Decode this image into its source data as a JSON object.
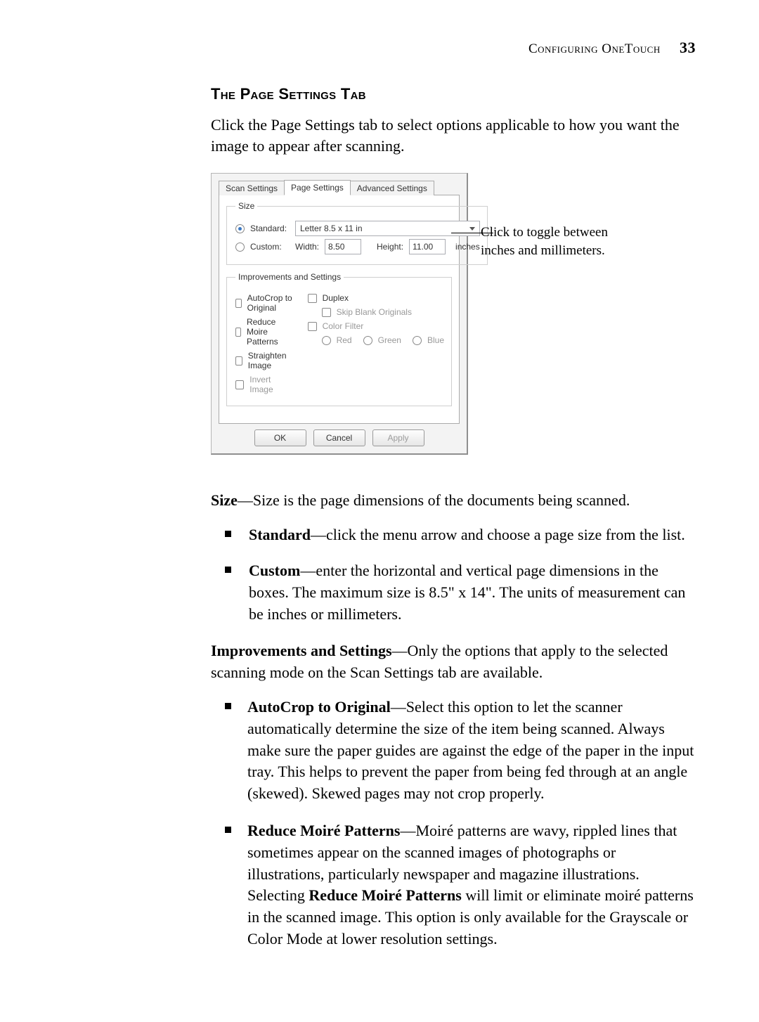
{
  "header": {
    "section": "Configuring OneTouch",
    "page_number": "33"
  },
  "title": "The Page Settings Tab",
  "intro": "Click the Page Settings tab to select options applicable to how you want the image to appear after scanning.",
  "dialog": {
    "tabs": {
      "scan": "Scan Settings",
      "page": "Page Settings",
      "advanced": "Advanced Settings"
    },
    "size_group": {
      "legend": "Size",
      "standard_label": "Standard:",
      "standard_value": "Letter 8.5 x 11 in",
      "custom_label": "Custom:",
      "width_label": "Width:",
      "width_value": "8.50",
      "height_label": "Height:",
      "height_value": "11.00",
      "units": "inches"
    },
    "improve_group": {
      "legend": "Improvements and Settings",
      "autocrop": "AutoCrop to Original",
      "moire": "Reduce Moire Patterns",
      "straighten": "Straighten Image",
      "invert": "Invert Image",
      "duplex": "Duplex",
      "skip_blank": "Skip Blank Originals",
      "color_filter": "Color Filter",
      "red": "Red",
      "green": "Green",
      "blue": "Blue"
    },
    "buttons": {
      "ok": "OK",
      "cancel": "Cancel",
      "apply": "Apply"
    }
  },
  "callout": "Click to toggle between inches and millimeters.",
  "body": {
    "size_para_lead": "Size",
    "size_para_rest": "—Size is the page dimensions of the documents being scanned.",
    "standard_lead": "Standard",
    "standard_rest": "—click the menu arrow and choose a page size from the list.",
    "custom_lead": "Custom",
    "custom_rest": "—enter the horizontal and vertical page dimensions in the boxes. The maximum size is 8.5\" x 14\". The units of measurement can be inches or millimeters.",
    "improve_lead": "Improvements and Settings",
    "improve_rest": "—Only the options that apply to the selected scanning mode on the Scan Settings tab are available.",
    "autocrop_lead": "AutoCrop to Original",
    "autocrop_rest": "—Select this option to let the scanner automatically determine the size of the item being scanned. Always make sure the paper guides are against the edge of the paper in the input tray. This helps to prevent the paper from being fed through at an angle (skewed). Skewed pages may not crop properly.",
    "moire_lead": "Reduce Moiré Patterns",
    "moire_rest_1": "—Moiré patterns are wavy, rippled lines that sometimes appear on the scanned images of photographs or illustrations, particularly newspaper and magazine illustrations. Selecting ",
    "moire_bold_inner": "Reduce Moiré Patterns",
    "moire_rest_2": " will limit or eliminate moiré patterns in the scanned image. This option is only available for the Grayscale or Color Mode at lower resolution settings."
  }
}
